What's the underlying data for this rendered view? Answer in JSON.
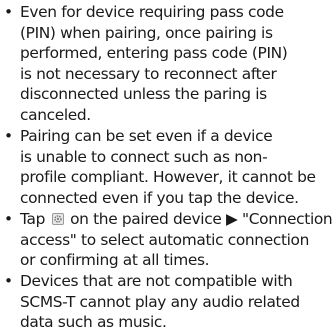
{
  "notes": {
    "bullet_glyph": "•",
    "items": [
      {
        "lines": [
          "Even for device requiring pass code",
          "(PIN) when pairing, once pairing is",
          "performed, entering pass code (PIN)",
          "is not necessary to reconnect after",
          "disconnected unless the paring is",
          "canceled."
        ]
      },
      {
        "lines": [
          "Pairing can be set even if a device",
          "is unable to connect such as non-",
          "profile compliant. However, it cannot be",
          "connected even if you tap the device."
        ]
      },
      {
        "line1_pre": "Tap",
        "icon": "gear-icon",
        "line1_post": "on the paired device ▶ \"Connection",
        "lines": [
          "access\" to select automatic connection",
          "or confirming at all times."
        ]
      },
      {
        "lines": [
          "Devices that are not compatible with",
          "SCMS-T cannot play any audio related",
          "data such as music."
        ]
      }
    ]
  }
}
